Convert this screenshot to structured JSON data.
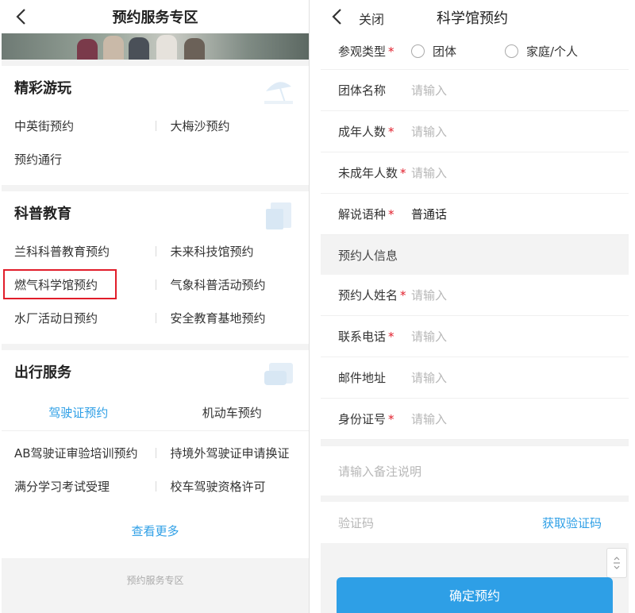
{
  "left": {
    "nav": {
      "title": "预约服务专区"
    },
    "sections": {
      "play": {
        "title": "精彩游玩",
        "items": [
          "中英街预约",
          "大梅沙预约",
          "预约通行"
        ]
      },
      "science": {
        "title": "科普教育",
        "items": [
          "兰科科普教育预约",
          "未来科技馆预约",
          "燃气科学馆预约",
          "气象科普活动预约",
          "水厂活动日预约",
          "安全教育基地预约"
        ]
      },
      "travel": {
        "title": "出行服务",
        "tabs": [
          "驾驶证预约",
          "机动车预约"
        ],
        "active_tab": 0,
        "items": [
          "AB驾驶证审验培训预约",
          "持境外驾驶证申请换证",
          "满分学习考试受理",
          "校车驾驶资格许可"
        ],
        "more": "查看更多"
      }
    },
    "footer": "预约服务专区"
  },
  "right": {
    "nav": {
      "close": "关闭",
      "title": "科学馆预约"
    },
    "visit_type": {
      "label": "参观类型",
      "options": [
        "团体",
        "家庭/个人"
      ]
    },
    "fields": [
      {
        "label": "团体名称",
        "required": false,
        "placeholder": "请输入"
      },
      {
        "label": "成年人数",
        "required": true,
        "placeholder": "请输入"
      },
      {
        "label": "未成年人数",
        "required": true,
        "placeholder": "请输入"
      },
      {
        "label": "解说语种",
        "required": true,
        "value": "普通话"
      }
    ],
    "booker_header": "预约人信息",
    "booker_fields": [
      {
        "label": "预约人姓名",
        "required": true,
        "placeholder": "请输入"
      },
      {
        "label": "联系电话",
        "required": true,
        "placeholder": "请输入"
      },
      {
        "label": "邮件地址",
        "required": false,
        "placeholder": "请输入"
      },
      {
        "label": "身份证号",
        "required": true,
        "placeholder": "请输入"
      }
    ],
    "remark_placeholder": "请输入备注说明",
    "verify": {
      "placeholder": "验证码",
      "get_code": "获取验证码"
    },
    "submit": "确定预约",
    "required_mark": "*"
  },
  "colors": {
    "accent": "#2e9fe6",
    "required": "#e11d2a",
    "highlight": "#e11d2a"
  }
}
